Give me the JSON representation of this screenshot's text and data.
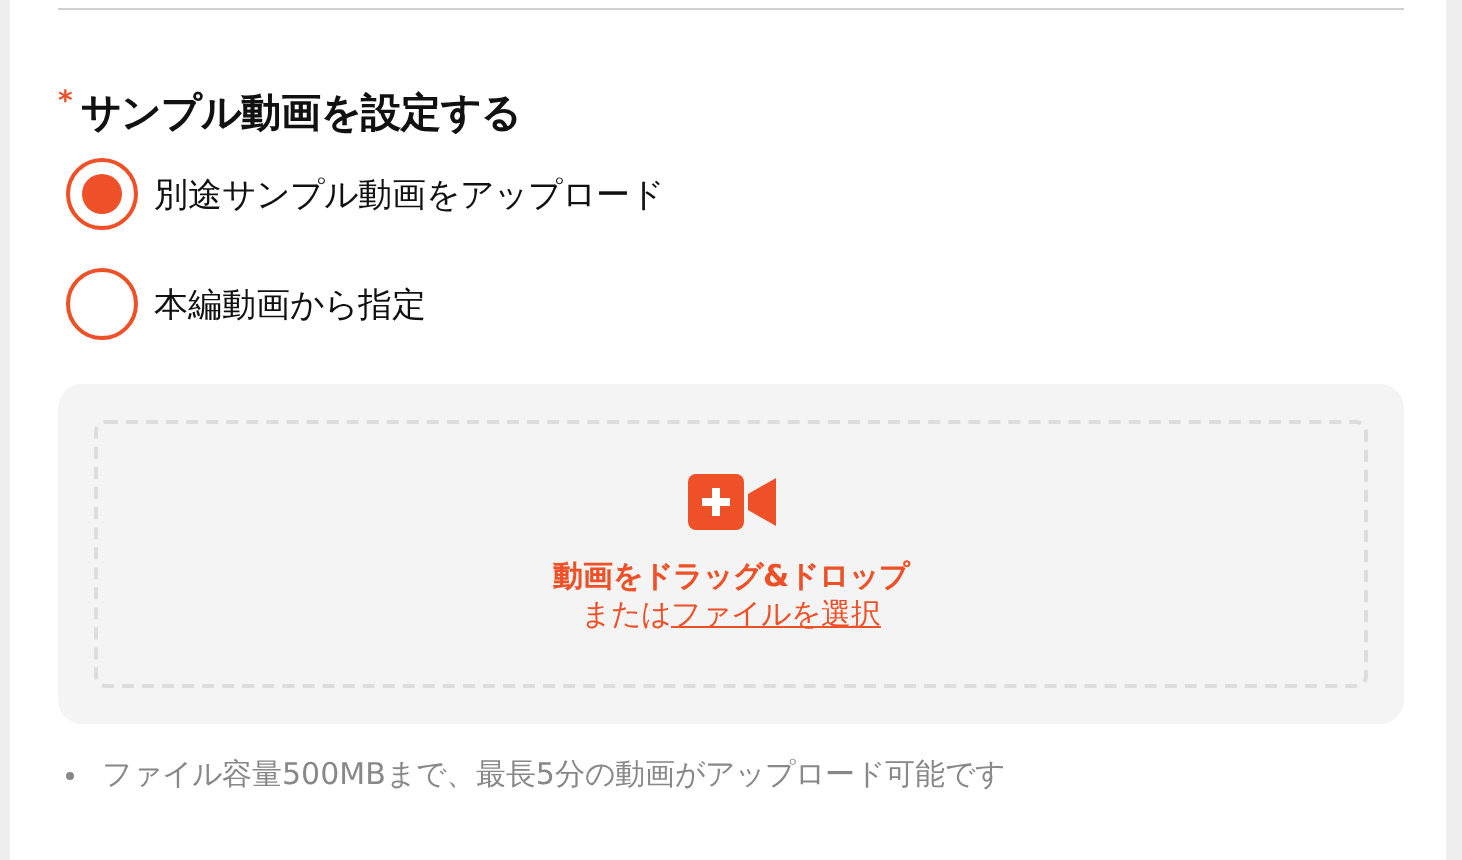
{
  "section": {
    "title": "サンプル動画を設定する",
    "required": true,
    "required_mark": "*"
  },
  "options": [
    {
      "label": "別途サンプル動画をアップロード",
      "selected": true
    },
    {
      "label": "本編動画から指定",
      "selected": false
    }
  ],
  "dropzone": {
    "title": "動画をドラッグ&ドロップ",
    "subtext": "または",
    "link": "ファイルを選択"
  },
  "notes": [
    "ファイル容量500MBまで、最長5分の動画がアップロード可能です"
  ]
}
